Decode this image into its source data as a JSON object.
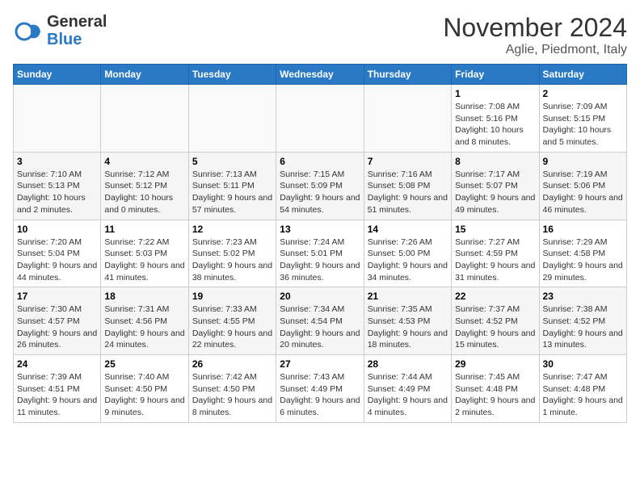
{
  "header": {
    "logo_line1": "General",
    "logo_line2": "Blue",
    "month": "November 2024",
    "location": "Aglie, Piedmont, Italy"
  },
  "weekdays": [
    "Sunday",
    "Monday",
    "Tuesday",
    "Wednesday",
    "Thursday",
    "Friday",
    "Saturday"
  ],
  "weeks": [
    [
      {
        "day": "",
        "info": ""
      },
      {
        "day": "",
        "info": ""
      },
      {
        "day": "",
        "info": ""
      },
      {
        "day": "",
        "info": ""
      },
      {
        "day": "",
        "info": ""
      },
      {
        "day": "1",
        "info": "Sunrise: 7:08 AM\nSunset: 5:16 PM\nDaylight: 10 hours and 8 minutes."
      },
      {
        "day": "2",
        "info": "Sunrise: 7:09 AM\nSunset: 5:15 PM\nDaylight: 10 hours and 5 minutes."
      }
    ],
    [
      {
        "day": "3",
        "info": "Sunrise: 7:10 AM\nSunset: 5:13 PM\nDaylight: 10 hours and 2 minutes."
      },
      {
        "day": "4",
        "info": "Sunrise: 7:12 AM\nSunset: 5:12 PM\nDaylight: 10 hours and 0 minutes."
      },
      {
        "day": "5",
        "info": "Sunrise: 7:13 AM\nSunset: 5:11 PM\nDaylight: 9 hours and 57 minutes."
      },
      {
        "day": "6",
        "info": "Sunrise: 7:15 AM\nSunset: 5:09 PM\nDaylight: 9 hours and 54 minutes."
      },
      {
        "day": "7",
        "info": "Sunrise: 7:16 AM\nSunset: 5:08 PM\nDaylight: 9 hours and 51 minutes."
      },
      {
        "day": "8",
        "info": "Sunrise: 7:17 AM\nSunset: 5:07 PM\nDaylight: 9 hours and 49 minutes."
      },
      {
        "day": "9",
        "info": "Sunrise: 7:19 AM\nSunset: 5:06 PM\nDaylight: 9 hours and 46 minutes."
      }
    ],
    [
      {
        "day": "10",
        "info": "Sunrise: 7:20 AM\nSunset: 5:04 PM\nDaylight: 9 hours and 44 minutes."
      },
      {
        "day": "11",
        "info": "Sunrise: 7:22 AM\nSunset: 5:03 PM\nDaylight: 9 hours and 41 minutes."
      },
      {
        "day": "12",
        "info": "Sunrise: 7:23 AM\nSunset: 5:02 PM\nDaylight: 9 hours and 38 minutes."
      },
      {
        "day": "13",
        "info": "Sunrise: 7:24 AM\nSunset: 5:01 PM\nDaylight: 9 hours and 36 minutes."
      },
      {
        "day": "14",
        "info": "Sunrise: 7:26 AM\nSunset: 5:00 PM\nDaylight: 9 hours and 34 minutes."
      },
      {
        "day": "15",
        "info": "Sunrise: 7:27 AM\nSunset: 4:59 PM\nDaylight: 9 hours and 31 minutes."
      },
      {
        "day": "16",
        "info": "Sunrise: 7:29 AM\nSunset: 4:58 PM\nDaylight: 9 hours and 29 minutes."
      }
    ],
    [
      {
        "day": "17",
        "info": "Sunrise: 7:30 AM\nSunset: 4:57 PM\nDaylight: 9 hours and 26 minutes."
      },
      {
        "day": "18",
        "info": "Sunrise: 7:31 AM\nSunset: 4:56 PM\nDaylight: 9 hours and 24 minutes."
      },
      {
        "day": "19",
        "info": "Sunrise: 7:33 AM\nSunset: 4:55 PM\nDaylight: 9 hours and 22 minutes."
      },
      {
        "day": "20",
        "info": "Sunrise: 7:34 AM\nSunset: 4:54 PM\nDaylight: 9 hours and 20 minutes."
      },
      {
        "day": "21",
        "info": "Sunrise: 7:35 AM\nSunset: 4:53 PM\nDaylight: 9 hours and 18 minutes."
      },
      {
        "day": "22",
        "info": "Sunrise: 7:37 AM\nSunset: 4:52 PM\nDaylight: 9 hours and 15 minutes."
      },
      {
        "day": "23",
        "info": "Sunrise: 7:38 AM\nSunset: 4:52 PM\nDaylight: 9 hours and 13 minutes."
      }
    ],
    [
      {
        "day": "24",
        "info": "Sunrise: 7:39 AM\nSunset: 4:51 PM\nDaylight: 9 hours and 11 minutes."
      },
      {
        "day": "25",
        "info": "Sunrise: 7:40 AM\nSunset: 4:50 PM\nDaylight: 9 hours and 9 minutes."
      },
      {
        "day": "26",
        "info": "Sunrise: 7:42 AM\nSunset: 4:50 PM\nDaylight: 9 hours and 8 minutes."
      },
      {
        "day": "27",
        "info": "Sunrise: 7:43 AM\nSunset: 4:49 PM\nDaylight: 9 hours and 6 minutes."
      },
      {
        "day": "28",
        "info": "Sunrise: 7:44 AM\nSunset: 4:49 PM\nDaylight: 9 hours and 4 minutes."
      },
      {
        "day": "29",
        "info": "Sunrise: 7:45 AM\nSunset: 4:48 PM\nDaylight: 9 hours and 2 minutes."
      },
      {
        "day": "30",
        "info": "Sunrise: 7:47 AM\nSunset: 4:48 PM\nDaylight: 9 hours and 1 minute."
      }
    ]
  ]
}
